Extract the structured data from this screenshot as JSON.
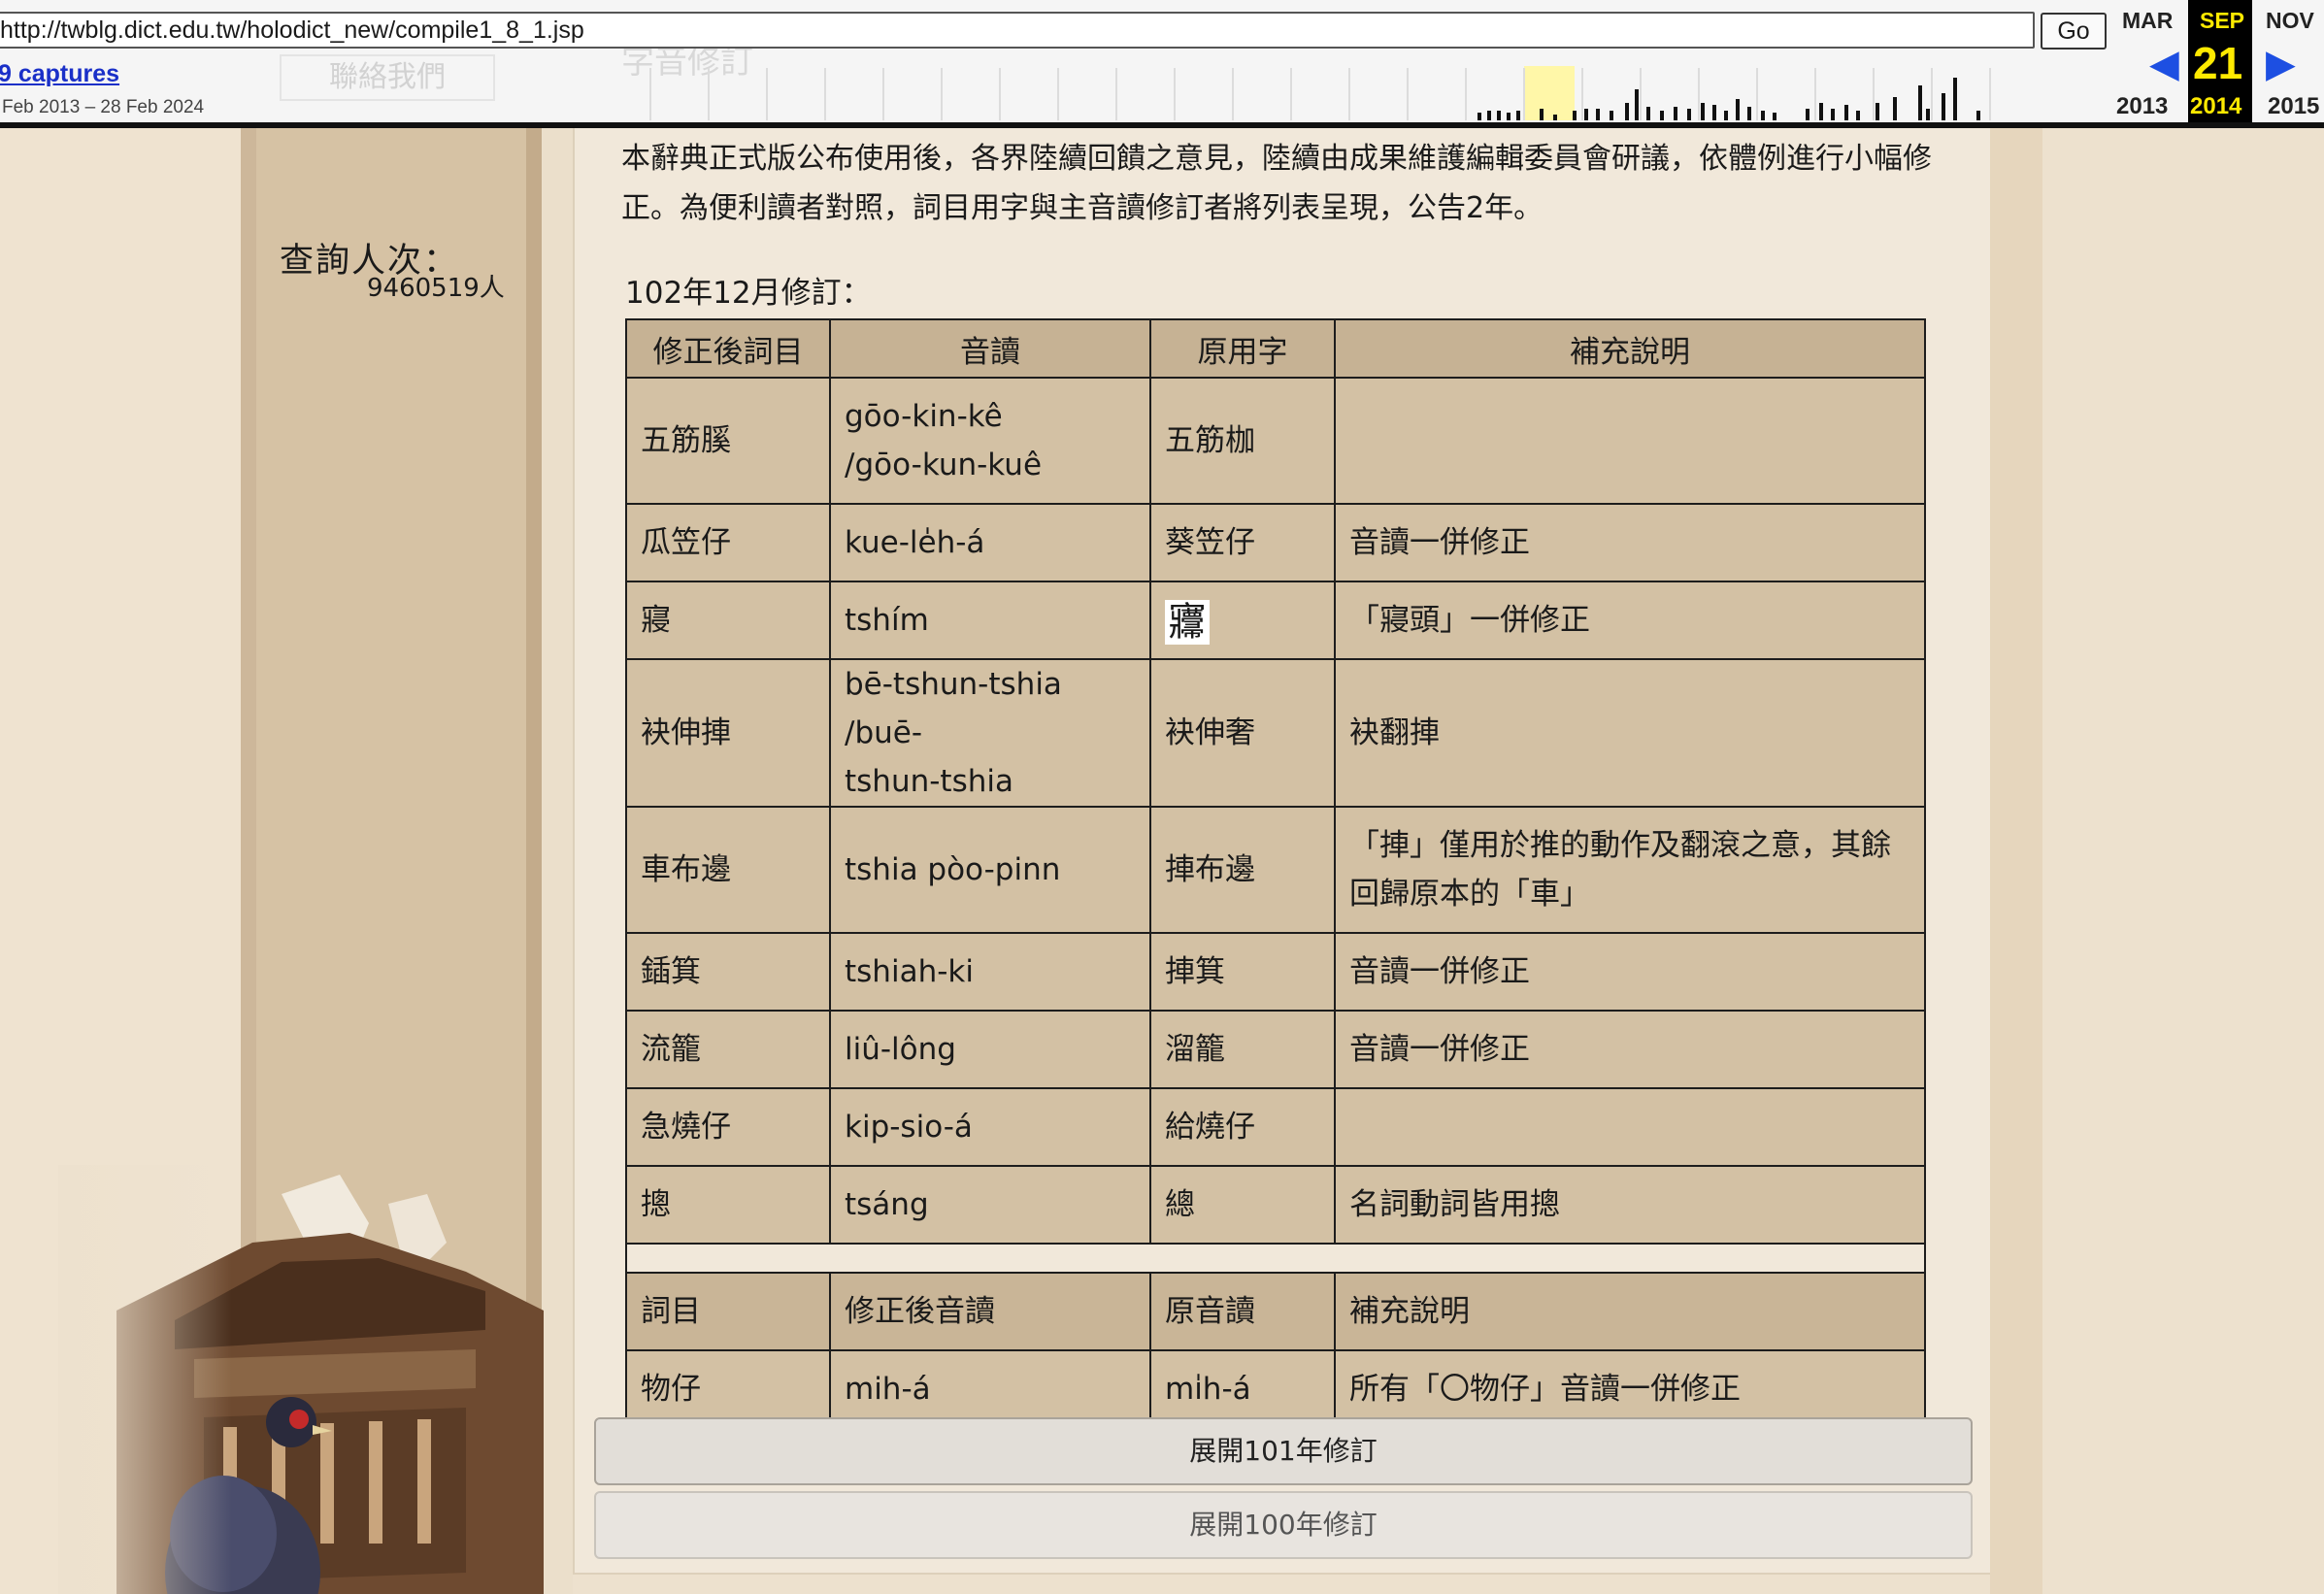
{
  "wayback": {
    "url": "http://twblg.dict.edu.tw/holodict_new/compile1_8_1.jsp",
    "go_label": "Go",
    "captures_label": "9 captures",
    "date_range": "Feb 2013 – 28 Feb 2024",
    "prev_month": "MAR",
    "current_month": "SEP",
    "next_month": "NOV",
    "current_day": "21",
    "prev_year": "2013",
    "current_year": "2014",
    "next_year": "2015",
    "ghost_menu_text": "聯絡我們",
    "ghost_title_text": "字音修訂"
  },
  "sidebar": {
    "visit_label": "查詢人次：",
    "visit_count": "9460519人"
  },
  "content": {
    "notice": "本辭典正式版公布使用後，各界陸續回饋之意見，陸續由成果維護編輯委員會研議，依體例進行小幅修正。為便利讀者對照，詞目用字與主音讀修訂者將列表呈現，公告2年。",
    "revision_heading": "102年12月修訂：",
    "table_headers": [
      "修正後詞目",
      "音讀",
      "原用字",
      "補充說明"
    ],
    "rows": [
      {
        "word": "五筋膎",
        "reading": "gōo-kin-kê /gōo-kun-kuê",
        "original": "五筋枷",
        "note": ""
      },
      {
        "word": "瓜笠仔",
        "reading": "kue-le̍h-á",
        "original": "葵笠仔",
        "note": "音讀一併修正"
      },
      {
        "word": "寢",
        "reading": "tshím",
        "original": "㝲",
        "note": "「寢頭」一併修正"
      },
      {
        "word": "袂伸捙",
        "reading": "bē-tshun-tshia /buē-tshun-tshia",
        "original": "袂伸奢",
        "note": "袂翻捙"
      },
      {
        "word": "車布邊",
        "reading": "tshia pòo-pinn",
        "original": "捙布邊",
        "note": "「捙」僅用於推的動作及翻滾之意，其餘回歸原本的「車」"
      },
      {
        "word": "鍤箕",
        "reading": "tshiah-ki",
        "original": "捙箕",
        "note": "音讀一併修正"
      },
      {
        "word": "流籠",
        "reading": "liû-lông",
        "original": "溜籠",
        "note": "音讀一併修正"
      },
      {
        "word": "急燒仔",
        "reading": "kip-sio-á",
        "original": "給燒仔",
        "note": ""
      },
      {
        "word": "摠",
        "reading": "tsáng",
        "original": "總",
        "note": "名詞動詞皆用摠"
      }
    ],
    "sub_headers": [
      "詞目",
      "修正後音讀",
      "原音讀",
      "補充說明"
    ],
    "sub_rows": [
      {
        "word": "物仔",
        "reading": "mih-á",
        "original": "mi̍h-á",
        "note": "所有「〇物仔」音讀一併修正"
      }
    ],
    "expand_101": "展開101年修訂",
    "expand_100": "展開100年修訂"
  }
}
